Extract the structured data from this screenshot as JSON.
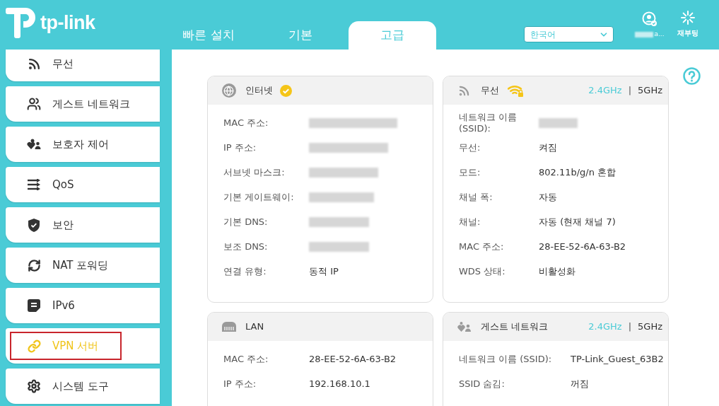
{
  "header": {
    "logo_text": "tp-link",
    "tabs": [
      {
        "label": "빠른 설치",
        "selected": false
      },
      {
        "label": "기본",
        "selected": false
      },
      {
        "label": "고급",
        "selected": true
      }
    ],
    "language": "한국어",
    "account": {
      "name_tail": "a..."
    },
    "reboot": {
      "label": "재부팅"
    }
  },
  "sidebar": {
    "items": [
      {
        "label": "무선",
        "selected": false,
        "annotated": false
      },
      {
        "label": "게스트 네트워크",
        "selected": false,
        "annotated": false
      },
      {
        "label": "보호자 제어",
        "selected": false,
        "annotated": false
      },
      {
        "label": "QoS",
        "selected": false,
        "annotated": false
      },
      {
        "label": "보안",
        "selected": false,
        "annotated": false
      },
      {
        "label": "NAT 포워딩",
        "selected": false,
        "annotated": false
      },
      {
        "label": "IPv6",
        "selected": false,
        "annotated": false
      },
      {
        "label": "VPN 서버",
        "selected": true,
        "annotated": true
      },
      {
        "label": "시스템 도구",
        "selected": false,
        "annotated": false
      }
    ]
  },
  "cards": [
    {
      "kind": "internet",
      "title": "인터넷",
      "connected": true,
      "rows": [
        {
          "label": "MAC 주소:",
          "redacted": true
        },
        {
          "label": "IP 주소:",
          "redacted": true
        },
        {
          "label": "서브넷 마스크:",
          "redacted": true
        },
        {
          "label": "기본 게이트웨이:",
          "redacted": true
        },
        {
          "label": "기본 DNS:",
          "redacted": true
        },
        {
          "label": "보조 DNS:",
          "redacted": true
        },
        {
          "label": "연결 유형:",
          "value": "동적 IP",
          "redacted": false
        }
      ]
    },
    {
      "kind": "wireless",
      "title": "무선",
      "enabled": true,
      "bands": [
        {
          "label": "2.4GHz",
          "selected": true
        },
        {
          "label": "5GHz",
          "selected": false
        }
      ],
      "band_separator": "|",
      "rows": [
        {
          "label": "네트워크 이름 (SSID):",
          "redacted": true
        },
        {
          "label": "무선:",
          "value": "켜짐",
          "redacted": false
        },
        {
          "label": "모드:",
          "value": "802.11b/g/n 혼합",
          "redacted": false
        },
        {
          "label": "채널 폭:",
          "value": "자동",
          "redacted": false
        },
        {
          "label": "채널:",
          "value": "자동 (현재 채널 7)",
          "redacted": false
        },
        {
          "label": "MAC 주소:",
          "value": "28-EE-52-6A-63-B2",
          "redacted": false
        },
        {
          "label": "WDS 상태:",
          "value": "비활성화",
          "redacted": false
        }
      ]
    },
    {
      "kind": "lan",
      "title": "LAN",
      "rows": [
        {
          "label": "MAC 주소:",
          "value": "28-EE-52-6A-63-B2",
          "redacted": false
        },
        {
          "label": "IP 주소:",
          "value": "192.168.10.1",
          "redacted": false
        }
      ]
    },
    {
      "kind": "guest",
      "title": "게스트 네트워크",
      "bands": [
        {
          "label": "2.4GHz",
          "selected": true
        },
        {
          "label": "5GHz",
          "selected": false
        }
      ],
      "band_separator": "|",
      "rows": [
        {
          "label": "네트워크 이름 (SSID):",
          "value": "TP-Link_Guest_63B2",
          "redacted": false
        },
        {
          "label": "SSID 숨김:",
          "value": "꺼짐",
          "redacted": false
        }
      ]
    }
  ]
}
